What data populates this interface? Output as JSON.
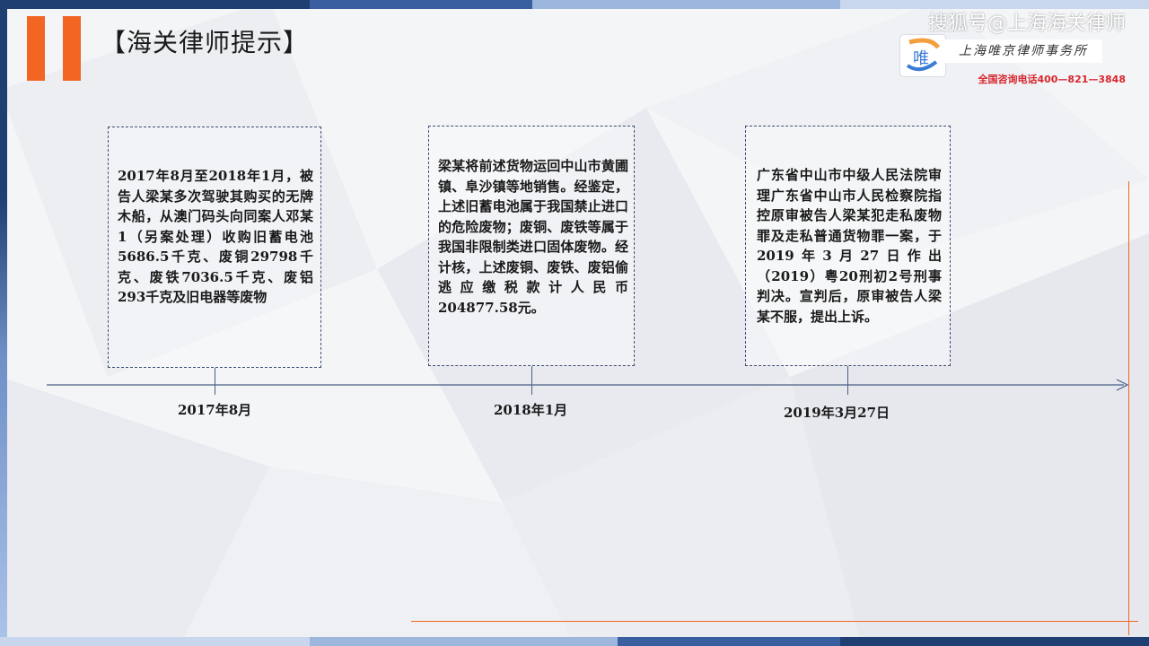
{
  "header": {
    "title": "【海关律师提示】"
  },
  "brand": {
    "name": "搜狐号@上海海关律师",
    "firm": "上海唯京律师事务所",
    "phone": "全国咨询电话400—821—3848",
    "logo_glyph": "唯"
  },
  "timeline": {
    "events": [
      {
        "date": "2017年8月",
        "text": "2017年8月至2018年1月，被告人梁某多次驾驶其购买的无牌木船，从澳门码头向同案人邓某1（另案处理）收购旧蓄电池5686.5千克、废铜29798千克、废铁7036.5千克、废铝293千克及旧电器等废物"
      },
      {
        "date": "2018年1月",
        "text": "梁某将前述货物运回中山市黄圃镇、阜沙镇等地销售。经鉴定，上述旧蓄电池属于我国禁止进口的危险废物；废铜、废铁等属于我国非限制类进口固体废物。经计核，上述废铜、废铁、废铝偷逃应缴税款计人民币204877.58元。"
      },
      {
        "date": "2019年3月27日",
        "text": "广东省中山市中级人民法院审理广东省中山市人民检察院指控原审被告人梁某犯走私废物罪及走私普通货物罪一案，于2019年3月27日作出（2019）粤20刑初2号刑事判决。宣判后，原审被告人梁某不服，提出上诉。"
      }
    ]
  },
  "colors": {
    "accent": "#f26522",
    "navy": "#1f3e72",
    "phone_red": "#d8262c"
  }
}
